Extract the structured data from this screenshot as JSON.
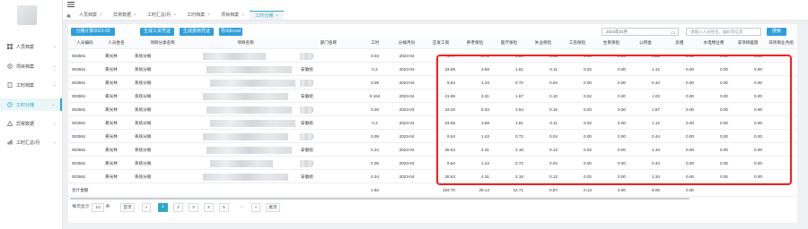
{
  "sidebar": {
    "items": [
      {
        "label": "人员档案",
        "icon": "grid-icon",
        "active": false
      },
      {
        "label": "项目档案",
        "icon": "settings-icon",
        "active": false
      },
      {
        "label": "工时档案",
        "icon": "document-icon",
        "active": false
      },
      {
        "label": "工时分摊",
        "icon": "clock-icon",
        "active": true
      },
      {
        "label": "异常数据",
        "icon": "warning-icon",
        "active": false
      },
      {
        "label": "工时汇总/月",
        "icon": "chart-icon",
        "active": false
      }
    ]
  },
  "tabs": [
    {
      "label": "人员档案"
    },
    {
      "label": "异常数据"
    },
    {
      "label": "工时汇总/月"
    },
    {
      "label": "工时档案"
    },
    {
      "label": "项目档案"
    },
    {
      "label": "工时分摊",
      "active": true
    }
  ],
  "toolbar": {
    "btn1": "分摊计算2023-03",
    "btn2": "生成工资凭证",
    "btn3": "生成费用凭证",
    "btn4": "导出Excel",
    "date_value": "2023年04月",
    "search_placeholder": "请输入人员姓名、编码等信息",
    "search_label": "搜索"
  },
  "table": {
    "headers": [
      "人员编码",
      "人员姓名",
      "项目分类名称",
      "项目名称",
      "部门名称",
      "工时",
      "分摊月份",
      "应发工资",
      "养老保险",
      "医疗保险",
      "失业保险",
      "工伤保险",
      "生育保险",
      "公积金",
      "房租",
      "水电物业费",
      "非项目差旅",
      "非项目业务招"
    ],
    "rows": [
      [
        "003591",
        "黄光林",
        "系统分摊",
        "547_tb1",
        "安徽组",
        "0.04",
        "2023-04",
        "4.77",
        "0.71",
        "0.36",
        "0.02",
        "0.00",
        "0.00",
        "0.22",
        "0.00",
        "0.00",
        "0.00",
        ""
      ],
      [
        "003591",
        "黄光林",
        "系统分摊",
        "",
        "安徽组",
        "0.2",
        "2023-04",
        "23.85",
        "3.59",
        "1.81",
        "0.11",
        "0.02",
        "0.00",
        "1.12",
        "0.00",
        "0.00",
        "0.00",
        ""
      ],
      [
        "003591",
        "黄光林",
        "系统分摊",
        "",
        "安徽组",
        "0.08",
        "2023-04",
        "9.54",
        "1.43",
        "0.72",
        "0.04",
        "0.00",
        "0.00",
        "0.44",
        "0.00",
        "0.00",
        "0.00",
        ""
      ],
      [
        "003591",
        "黄光林",
        "系统分摊",
        "",
        "安徽组",
        "0.184",
        "2023-04",
        "21.95",
        "3.31",
        "1.67",
        "0.10",
        "0.02",
        "0.00",
        "1.03",
        "0.00",
        "0.00",
        "0.00",
        ""
      ],
      [
        "003591",
        "黄光林",
        "系统分摊",
        "",
        "安徽组",
        "0.28",
        "2023-04",
        "33.40",
        "5.03",
        "2.54",
        "0.15",
        "0.03",
        "0.00",
        "1.57",
        "0.00",
        "0.00",
        "0.00",
        ""
      ],
      [
        "003591",
        "黄光林",
        "系统分摊",
        "",
        "安徽组",
        "0.2",
        "2023-04",
        "23.85",
        "3.59",
        "1.81",
        "0.11",
        "0.02",
        "0.00",
        "1.12",
        "0.00",
        "0.00",
        "0.00",
        ""
      ],
      [
        "003591",
        "黄光林",
        "系统分摊",
        "",
        "安徽组",
        "0.08",
        "2023-04",
        "9.54",
        "1.43",
        "0.72",
        "0.04",
        "0.00",
        "0.00",
        "0.44",
        "0.00",
        "0.00",
        "0.00",
        ""
      ],
      [
        "003591",
        "黄光林",
        "系统分摊",
        "",
        "安徽组",
        "0.24",
        "2023-04",
        "28.63",
        "4.31",
        "2.18",
        "0.13",
        "0.02",
        "0.00",
        "1.34",
        "0.00",
        "0.00",
        "0.00",
        ""
      ],
      [
        "003591",
        "黄光林",
        "系统分摊",
        "cST",
        "安徽组",
        "0.08",
        "2023-04",
        "9.54",
        "1.43",
        "0.72",
        "0.04",
        "0.00",
        "0.00",
        "0.44",
        "0.00",
        "0.00",
        "0.00",
        ""
      ],
      [
        "003591",
        "黄光林",
        "系统分摊",
        "",
        "安徽组",
        "0.24",
        "2023-04",
        "28.63",
        "4.31",
        "2.18",
        "0.13",
        "0.02",
        "0.00",
        "1.34",
        "0.00",
        "0.00",
        "0.00",
        ""
      ]
    ],
    "totals": {
      "label": "合计金额",
      "hours": "1.62",
      "salary": "193.70",
      "pension": "29.14",
      "medical": "14.71",
      "unemployment": "0.87",
      "injury": "0.13",
      "maternity": "0.00",
      "fund": "9.06",
      "rent": "0.00"
    }
  },
  "pager": {
    "per_page_prefix": "每页显示",
    "per_page": "10",
    "per_page_suffix": "条",
    "first": "首页",
    "prev": "«",
    "pages": [
      "1",
      "2",
      "3",
      "4",
      "5"
    ],
    "ellipsis": "...",
    "next": "»",
    "last": "尾页"
  },
  "colors": {
    "accent": "#2aa9c5",
    "button": "#2f9fd9",
    "highlight": "#ff1a1a"
  }
}
